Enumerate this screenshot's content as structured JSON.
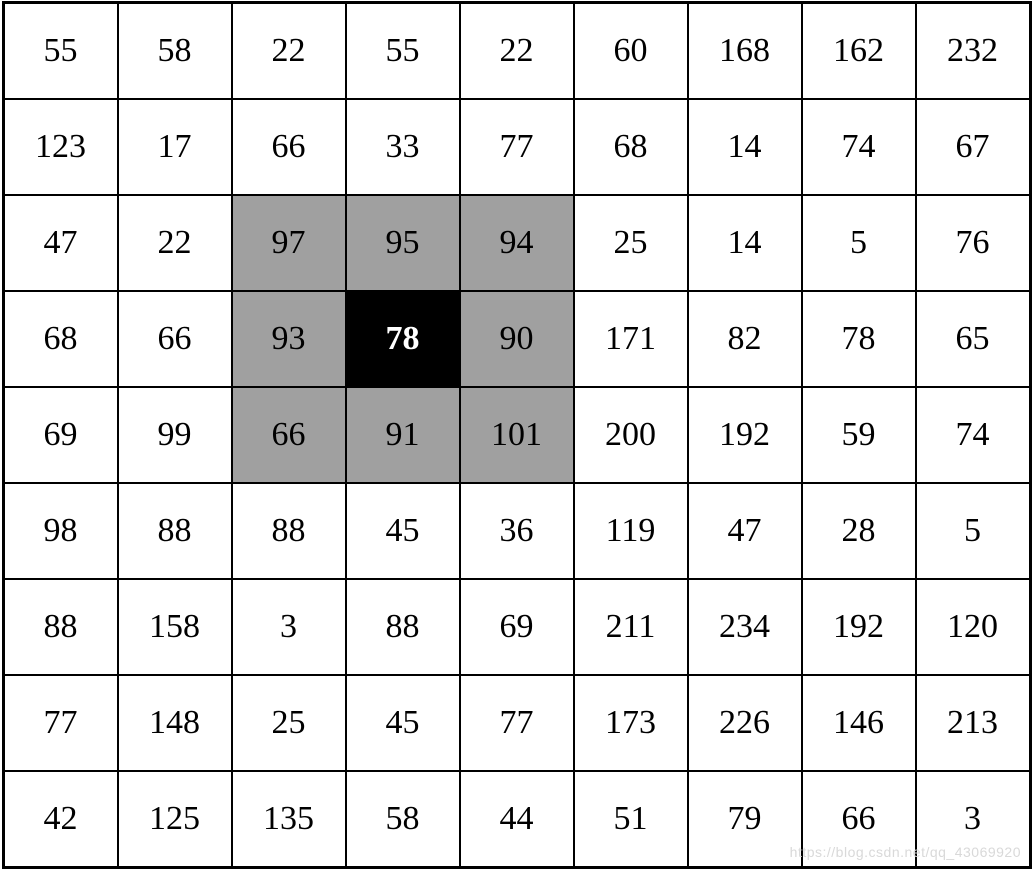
{
  "grid": {
    "rows": 9,
    "cols": 9,
    "cells": [
      [
        55,
        58,
        22,
        55,
        22,
        60,
        168,
        162,
        232
      ],
      [
        123,
        17,
        66,
        33,
        77,
        68,
        14,
        74,
        67
      ],
      [
        47,
        22,
        97,
        95,
        94,
        25,
        14,
        5,
        76
      ],
      [
        68,
        66,
        93,
        78,
        90,
        171,
        82,
        78,
        65
      ],
      [
        69,
        99,
        66,
        91,
        101,
        200,
        192,
        59,
        74
      ],
      [
        98,
        88,
        88,
        45,
        36,
        119,
        47,
        28,
        5
      ],
      [
        88,
        158,
        3,
        88,
        69,
        211,
        234,
        192,
        120
      ],
      [
        77,
        148,
        25,
        45,
        77,
        173,
        226,
        146,
        213
      ],
      [
        42,
        125,
        135,
        58,
        44,
        51,
        79,
        66,
        3
      ]
    ],
    "highlight": {
      "gray": [
        [
          2,
          2
        ],
        [
          2,
          3
        ],
        [
          2,
          4
        ],
        [
          3,
          2
        ],
        [
          3,
          4
        ],
        [
          4,
          2
        ],
        [
          4,
          3
        ],
        [
          4,
          4
        ]
      ],
      "black": [
        [
          3,
          3
        ]
      ]
    }
  },
  "watermark": "https://blog.csdn.net/qq_43069920"
}
